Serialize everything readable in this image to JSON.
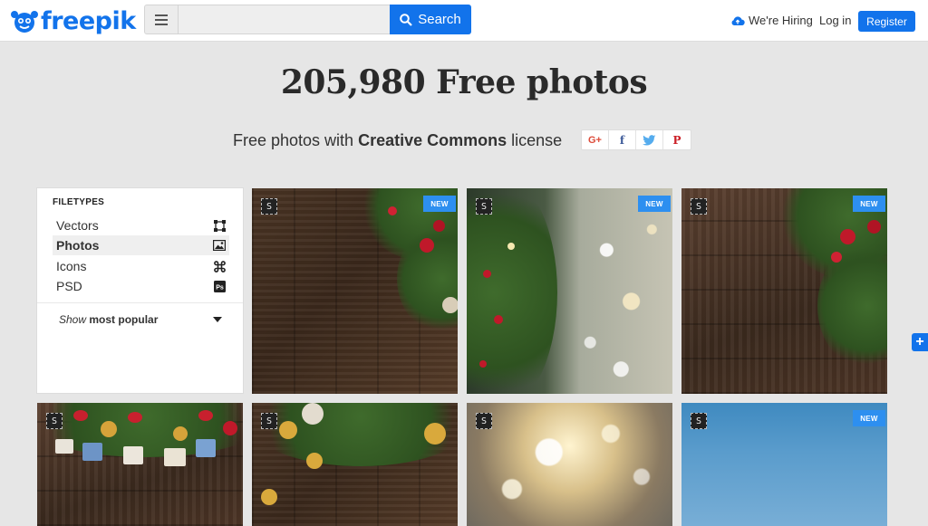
{
  "brand": {
    "name": "freepik",
    "color": "#1273eb"
  },
  "header": {
    "menu_icon": "hamburger-icon",
    "search_value": "",
    "search_button": "Search",
    "hiring": "We're Hiring",
    "login": "Log in",
    "register": "Register"
  },
  "hero": {
    "title": "205,980 Free photos",
    "subtitle_pre": "Free photos with ",
    "subtitle_bold": "Creative Commons",
    "subtitle_post": " license",
    "share": [
      "G+",
      "f",
      "twitter",
      "P"
    ]
  },
  "sidebar": {
    "heading": "FILETYPES",
    "items": [
      {
        "label": "Vectors",
        "icon": "vector-icon",
        "active": false
      },
      {
        "label": "Photos",
        "icon": "image-icon",
        "active": true
      },
      {
        "label": "Icons",
        "icon": "command-icon",
        "active": false
      },
      {
        "label": "PSD",
        "icon": "ps-icon",
        "active": false
      }
    ],
    "popular_show": "Show",
    "popular_label": "most popular"
  },
  "badges": {
    "new": "NEW",
    "s": "S"
  },
  "fab_label": "+"
}
